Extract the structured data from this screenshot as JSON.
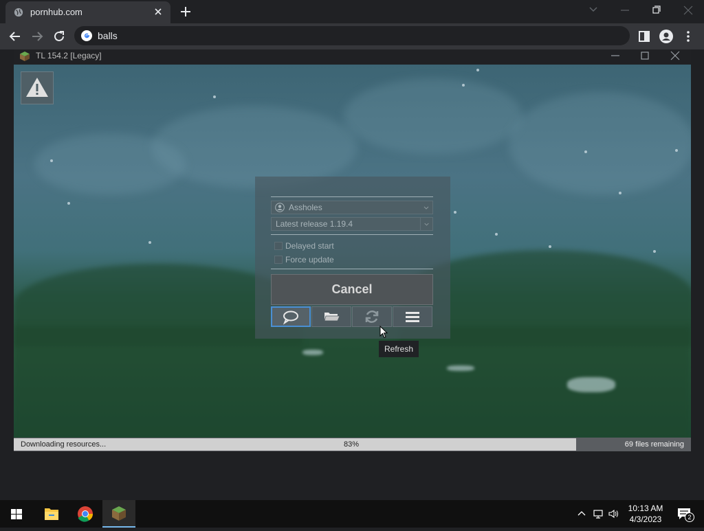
{
  "browser": {
    "tab_title": "pornhub.com",
    "address_text": "balls"
  },
  "launcher": {
    "window_title": "TL 154.2 [Legacy]",
    "account_select": "Assholes",
    "version_select": "Latest release 1.19.4",
    "delayed_start_label": "Delayed start",
    "force_update_label": "Force update",
    "cancel_label": "Cancel",
    "tooltip": "Refresh",
    "icons": [
      "chat-icon",
      "folder-icon",
      "refresh-icon",
      "menu-icon"
    ],
    "progress": {
      "status": "Downloading resources...",
      "percent_text": "83%",
      "fraction": 0.83,
      "remaining": "69 files remaining"
    }
  },
  "taskbar": {
    "time": "10:13 AM",
    "date": "4/3/2023",
    "notification_count": "2",
    "apps": [
      "start-icon",
      "file-explorer-icon",
      "chrome-icon",
      "minecraft-launcher-icon"
    ]
  },
  "colors": {
    "accent": "#4a8fd4",
    "chrome_dark": "#202124",
    "chrome_tab": "#35363a"
  }
}
